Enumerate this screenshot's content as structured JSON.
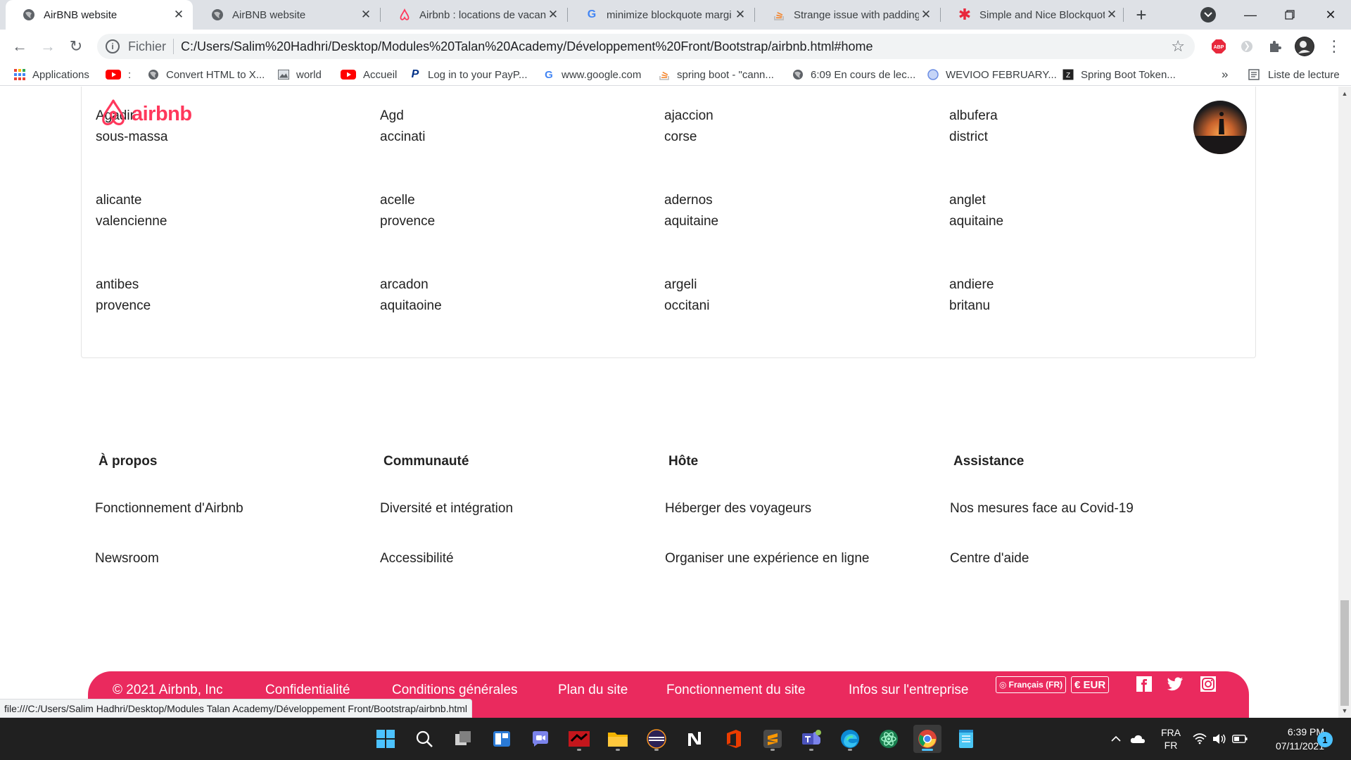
{
  "browser": {
    "tabs": [
      {
        "title": "AirBNB website",
        "icon": "globe-icon",
        "active": true
      },
      {
        "title": "AirBNB website",
        "icon": "globe-icon",
        "active": false
      },
      {
        "title": "Airbnb : locations de vacanc",
        "icon": "airbnb-icon",
        "active": false
      },
      {
        "title": "minimize blockquote margi",
        "icon": "google-icon",
        "active": false
      },
      {
        "title": "Strange issue with padding",
        "icon": "stackoverflow-icon",
        "active": false
      },
      {
        "title": "Simple and Nice Blockquote",
        "icon": "asterisk-icon",
        "active": false
      }
    ],
    "address": {
      "scheme_label": "Fichier",
      "url": "C:/Users/Salim%20Hadhri/Desktop/Modules%20Talan%20Academy/Développement%20Front/Bootstrap/airbnb.html#home"
    },
    "bookmarks": [
      {
        "label": "Applications",
        "icon": "apps-grid-icon"
      },
      {
        "label": ":",
        "icon": "youtube-icon"
      },
      {
        "label": "Convert HTML to X...",
        "icon": "globe-icon"
      },
      {
        "label": "world",
        "icon": "image-icon"
      },
      {
        "label": "Accueil",
        "icon": "youtube-icon"
      },
      {
        "label": "Log in to your PayP...",
        "icon": "paypal-icon"
      },
      {
        "label": "www.google.com",
        "icon": "google-icon"
      },
      {
        "label": "spring boot - \"cann...",
        "icon": "stackoverflow-icon"
      },
      {
        "label": "6:09 En cours de lec...",
        "icon": "globe-icon"
      },
      {
        "label": "WEVIOO FEBRUARY...",
        "icon": "circle-icon"
      },
      {
        "label": "Spring Boot Token...",
        "icon": "z-icon"
      }
    ],
    "bookmarks_overflow": "»",
    "reading_list": "Liste de lecture"
  },
  "page": {
    "logo_text": "airbnb",
    "destinations": [
      {
        "city": "Agadir",
        "region": "sous-massa"
      },
      {
        "city": "Agd",
        "region": "accinati"
      },
      {
        "city": "ajaccion",
        "region": "corse"
      },
      {
        "city": "albufera",
        "region": "district"
      },
      {
        "city": "alicante",
        "region": "valencienne"
      },
      {
        "city": "acelle",
        "region": "provence"
      },
      {
        "city": "adernos",
        "region": "aquitaine"
      },
      {
        "city": "anglet",
        "region": "aquitaine"
      },
      {
        "city": "antibes",
        "region": "provence"
      },
      {
        "city": "arcadon",
        "region": "aquitaoine"
      },
      {
        "city": "argeli",
        "region": "occitani"
      },
      {
        "city": "andiere",
        "region": "britanu"
      }
    ],
    "footer_columns": [
      {
        "heading": "À propos",
        "links": [
          "Fonctionnement d'Airbnb",
          "Newsroom"
        ]
      },
      {
        "heading": "Communauté",
        "links": [
          "Diversité et intégration",
          "Accessibilité"
        ]
      },
      {
        "heading": "Hôte",
        "links": [
          "Héberger des voyageurs",
          "Organiser une expérience en ligne"
        ]
      },
      {
        "heading": "Assistance",
        "links": [
          "Nos mesures face au Covid-19",
          "Centre d'aide"
        ]
      }
    ],
    "bottom_bar": {
      "copyright": "© 2021 Airbnb, Inc",
      "links": [
        "Confidentialité",
        "Conditions générales",
        "Plan du site",
        "Fonctionnement du site",
        "Infos sur l'entreprise"
      ],
      "language_badge": "Français (FR)",
      "currency_badge": "€ EUR",
      "social_icons": [
        "facebook-icon",
        "twitter-icon",
        "instagram-icon"
      ],
      "color": "#ea2a5e"
    },
    "status_url": "file:///C:/Users/Salim Hadhri/Desktop/Modules Talan Academy/Développement Front/Bootstrap/airbnb.html"
  },
  "taskbar": {
    "lang_top": "FRA",
    "lang_bottom": "FR",
    "time": "6:39 PM",
    "date": "07/11/2021",
    "notification_count": "1"
  },
  "colors": {
    "brand": "#ff385c",
    "footer_bar": "#ea2a5e"
  }
}
